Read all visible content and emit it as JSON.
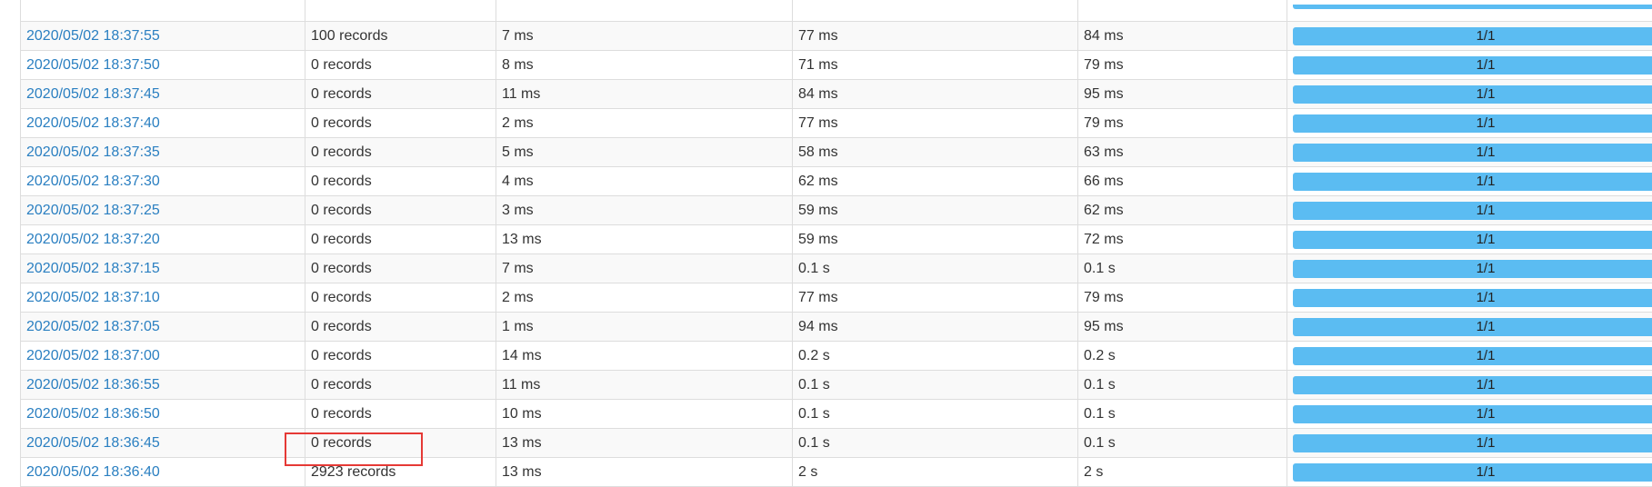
{
  "table": {
    "rows": [
      {
        "time": "2020/05/02 18:37:55",
        "records": "100 records",
        "c3": "7 ms",
        "c4": "77 ms",
        "c5": "84 ms",
        "progress": "1/1"
      },
      {
        "time": "2020/05/02 18:37:50",
        "records": "0 records",
        "c3": "8 ms",
        "c4": "71 ms",
        "c5": "79 ms",
        "progress": "1/1"
      },
      {
        "time": "2020/05/02 18:37:45",
        "records": "0 records",
        "c3": "11 ms",
        "c4": "84 ms",
        "c5": "95 ms",
        "progress": "1/1"
      },
      {
        "time": "2020/05/02 18:37:40",
        "records": "0 records",
        "c3": "2 ms",
        "c4": "77 ms",
        "c5": "79 ms",
        "progress": "1/1"
      },
      {
        "time": "2020/05/02 18:37:35",
        "records": "0 records",
        "c3": "5 ms",
        "c4": "58 ms",
        "c5": "63 ms",
        "progress": "1/1"
      },
      {
        "time": "2020/05/02 18:37:30",
        "records": "0 records",
        "c3": "4 ms",
        "c4": "62 ms",
        "c5": "66 ms",
        "progress": "1/1"
      },
      {
        "time": "2020/05/02 18:37:25",
        "records": "0 records",
        "c3": "3 ms",
        "c4": "59 ms",
        "c5": "62 ms",
        "progress": "1/1"
      },
      {
        "time": "2020/05/02 18:37:20",
        "records": "0 records",
        "c3": "13 ms",
        "c4": "59 ms",
        "c5": "72 ms",
        "progress": "1/1"
      },
      {
        "time": "2020/05/02 18:37:15",
        "records": "0 records",
        "c3": "7 ms",
        "c4": "0.1 s",
        "c5": "0.1 s",
        "progress": "1/1"
      },
      {
        "time": "2020/05/02 18:37:10",
        "records": "0 records",
        "c3": "2 ms",
        "c4": "77 ms",
        "c5": "79 ms",
        "progress": "1/1"
      },
      {
        "time": "2020/05/02 18:37:05",
        "records": "0 records",
        "c3": "1 ms",
        "c4": "94 ms",
        "c5": "95 ms",
        "progress": "1/1"
      },
      {
        "time": "2020/05/02 18:37:00",
        "records": "0 records",
        "c3": "14 ms",
        "c4": "0.2 s",
        "c5": "0.2 s",
        "progress": "1/1"
      },
      {
        "time": "2020/05/02 18:36:55",
        "records": "0 records",
        "c3": "11 ms",
        "c4": "0.1 s",
        "c5": "0.1 s",
        "progress": "1/1"
      },
      {
        "time": "2020/05/02 18:36:50",
        "records": "0 records",
        "c3": "10 ms",
        "c4": "0.1 s",
        "c5": "0.1 s",
        "progress": "1/1"
      },
      {
        "time": "2020/05/02 18:36:45",
        "records": "0 records",
        "c3": "13 ms",
        "c4": "0.1 s",
        "c5": "0.1 s",
        "progress": "1/1"
      },
      {
        "time": "2020/05/02 18:36:40",
        "records": "2923 records",
        "c3": "13 ms",
        "c4": "2 s",
        "c5": "2 s",
        "progress": "1/1"
      }
    ]
  },
  "colors": {
    "link": "#2a7fc1",
    "progress_bar": "#5bbcf2",
    "highlight_box": "#e53935"
  }
}
